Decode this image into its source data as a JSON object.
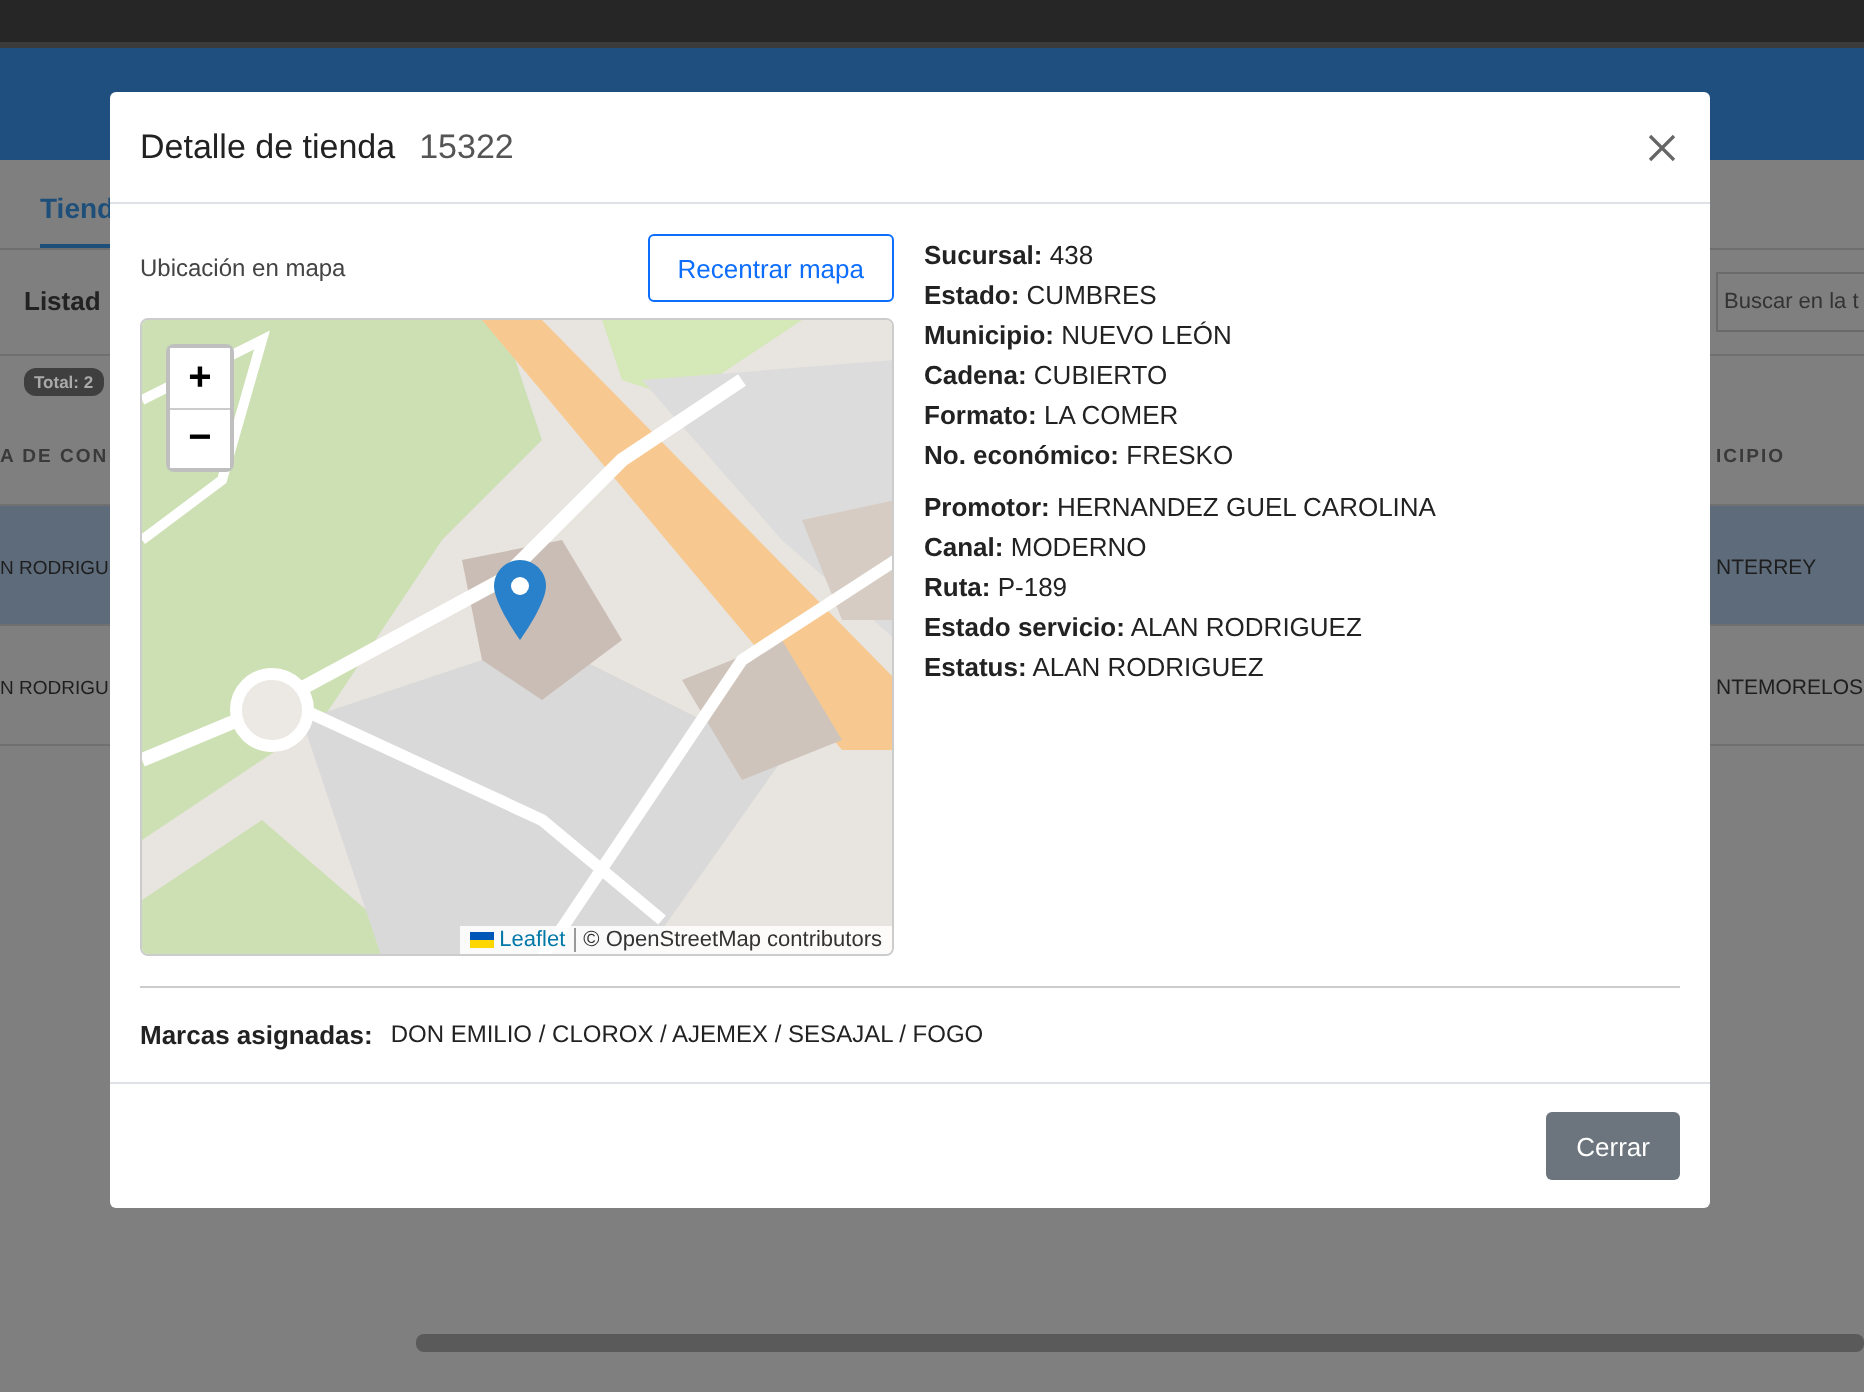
{
  "background": {
    "tab": "Tiend",
    "section_title": "Listad",
    "total_badge": "Total: 2",
    "search": {
      "placeholder": "Buscar en la t"
    },
    "columns": [
      "A DE CON",
      "ICIPIO"
    ],
    "rows": [
      {
        "cells": [
          "N RODRIGU",
          "NTERREY"
        ],
        "selected": true
      },
      {
        "cells": [
          "N RODRIGU",
          "NTEMORELOS"
        ],
        "selected": false
      }
    ]
  },
  "modal": {
    "title": "Detalle de tienda",
    "store_id": "15322",
    "map": {
      "label": "Ubicación en mapa",
      "recenter_button": "Recentrar mapa",
      "zoom_in": "+",
      "zoom_out": "−",
      "attribution_link": "Leaflet",
      "attribution": "© OpenStreetMap contributors"
    },
    "detail_groups": [
      [
        {
          "label": "Sucursal:",
          "value": "438"
        },
        {
          "label": "Estado:",
          "value": "CUMBRES"
        },
        {
          "label": "Municipio:",
          "value": "NUEVO LEÓN"
        },
        {
          "label": "Cadena:",
          "value": "CUBIERTO"
        },
        {
          "label": "Formato:",
          "value": "LA COMER"
        },
        {
          "label": "No. económico:",
          "value": "FRESKO"
        }
      ],
      [
        {
          "label": "Promotor:",
          "value": "HERNANDEZ GUEL CAROLINA"
        },
        {
          "label": "Canal:",
          "value": "MODERNO"
        },
        {
          "label": "Ruta:",
          "value": "P-189"
        },
        {
          "label": "Estado servicio:",
          "value": "ALAN RODRIGUEZ"
        },
        {
          "label": "Estatus:",
          "value": "ALAN RODRIGUEZ"
        }
      ]
    ],
    "brands": {
      "label": "Marcas asignadas:",
      "value": "DON EMILIO / CLOROX / AJEMEX / SESAJAL / FOGO"
    },
    "close_button": "Cerrar"
  }
}
